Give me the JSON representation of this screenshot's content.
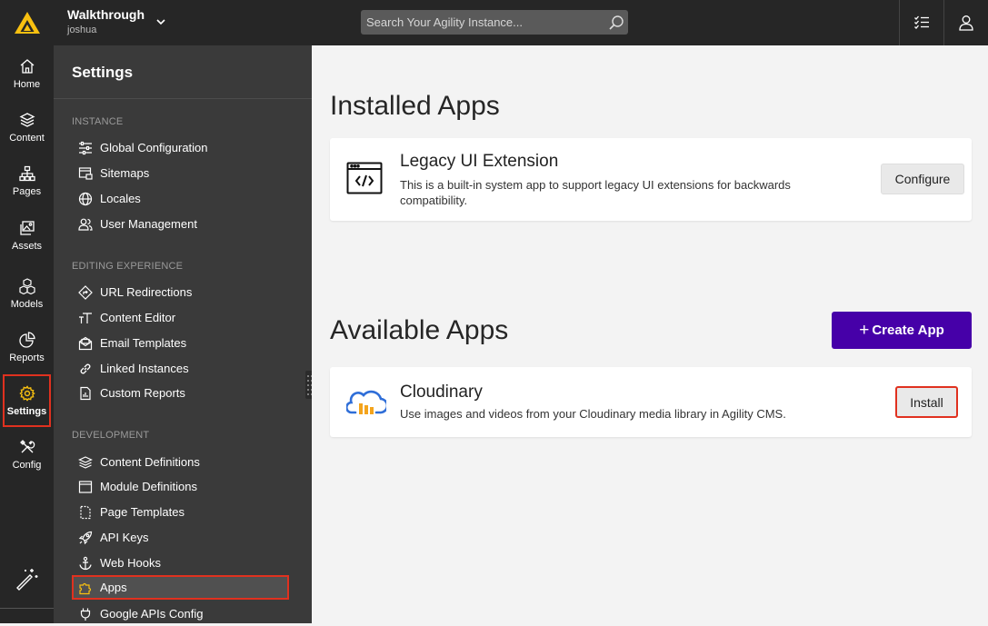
{
  "topbar": {
    "instance_name": "Walkthrough",
    "instance_user": "joshua",
    "search_placeholder": "Search Your Agility Instance..."
  },
  "rail": {
    "items": [
      {
        "label": "Home",
        "icon": "home-icon"
      },
      {
        "label": "Content",
        "icon": "layers-icon"
      },
      {
        "label": "Pages",
        "icon": "sitemap-icon"
      },
      {
        "label": "Assets",
        "icon": "images-icon"
      },
      {
        "label": "Models",
        "icon": "cubes-icon"
      },
      {
        "label": "Reports",
        "icon": "pie-chart-icon"
      },
      {
        "label": "Settings",
        "icon": "gear-icon"
      },
      {
        "label": "Config",
        "icon": "tools-icon"
      }
    ],
    "active": "Settings"
  },
  "settings": {
    "title": "Settings",
    "sections": [
      {
        "heading": "INSTANCE",
        "items": [
          "Global Configuration",
          "Sitemaps",
          "Locales",
          "User Management"
        ]
      },
      {
        "heading": "EDITING EXPERIENCE",
        "items": [
          "URL Redirections",
          "Content Editor",
          "Email Templates",
          "Linked Instances",
          "Custom Reports"
        ]
      },
      {
        "heading": "DEVELOPMENT",
        "items": [
          "Content Definitions",
          "Module Definitions",
          "Page Templates",
          "API Keys",
          "Web Hooks",
          "Apps",
          "Google APIs Config"
        ]
      }
    ],
    "active_item": "Apps"
  },
  "main": {
    "installed_heading": "Installed Apps",
    "installed": [
      {
        "title": "Legacy UI Extension",
        "description": "This is a built-in system app to support legacy UI extensions for backwards compatibility.",
        "button": "Configure",
        "icon": "code-window-icon"
      }
    ],
    "available_heading": "Available Apps",
    "create_label": "Create App",
    "available": [
      {
        "title": "Cloudinary",
        "description": "Use images and videos from your Cloudinary media library in Agility CMS.",
        "button": "Install",
        "icon": "cloudinary-logo-icon"
      }
    ]
  },
  "colors": {
    "topbar": "#262626",
    "rail": "#262626",
    "panel": "#3a3a3a",
    "accent_highlight": "#e0311f",
    "create_button": "#4600a8",
    "logo_yellow": "#f8c010"
  }
}
